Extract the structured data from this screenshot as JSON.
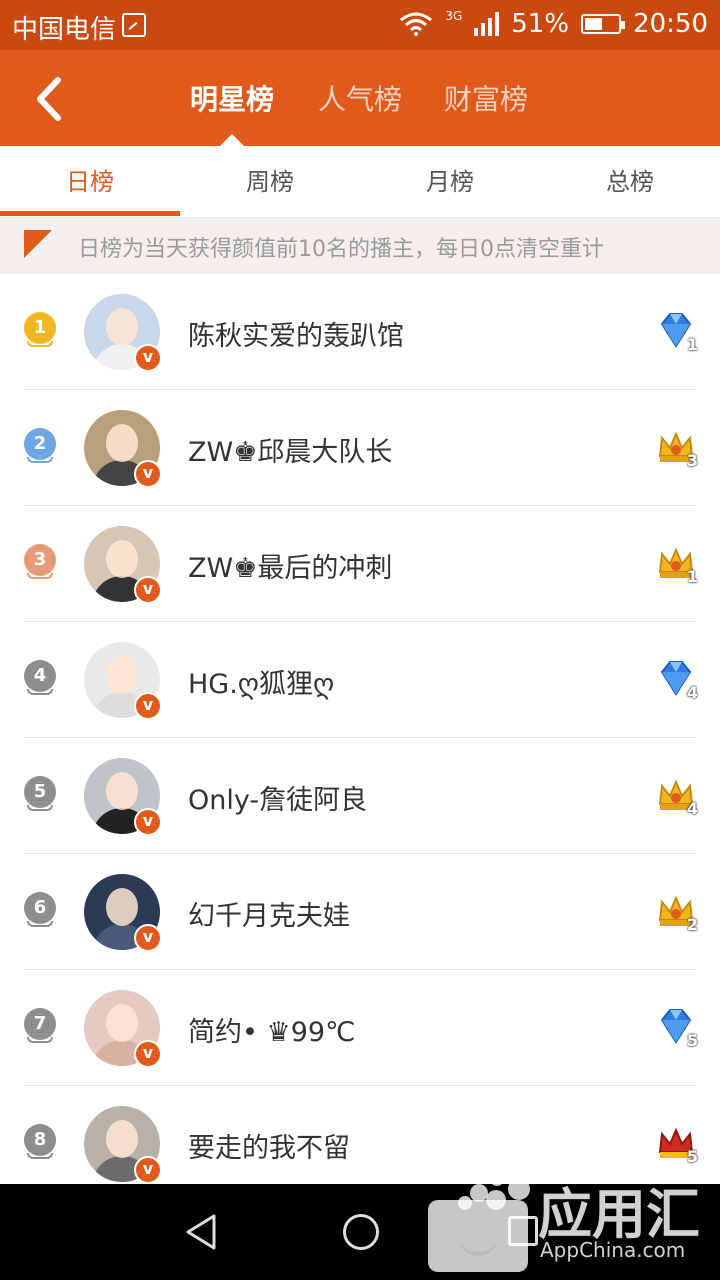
{
  "status_bar": {
    "carrier": "中国电信",
    "network": "3G",
    "battery": "51%",
    "time": "20:50"
  },
  "header": {
    "tabs": [
      {
        "label": "明星榜",
        "active": true
      },
      {
        "label": "人气榜",
        "active": false
      },
      {
        "label": "财富榜",
        "active": false
      }
    ]
  },
  "subtabs": [
    {
      "label": "日榜",
      "active": true
    },
    {
      "label": "周榜",
      "active": false
    },
    {
      "label": "月榜",
      "active": false
    },
    {
      "label": "总榜",
      "active": false
    }
  ],
  "notice": "日榜为当天获得颜值前10名的播主，每日0点清空重计",
  "colors": {
    "accent": "#e05a1c",
    "gold": "#f2b61e",
    "silver": "#6fa6e6",
    "bronze": "#e59b78",
    "gray_rank": "#8e8e8e"
  },
  "list": [
    {
      "rank": "1",
      "name": "陈秋实爱的轰趴馆",
      "badge": {
        "type": "diamond-icon",
        "level": "1"
      }
    },
    {
      "rank": "2",
      "name": "ZW♚邱晨大队长",
      "badge": {
        "type": "crown-icon",
        "level": "3"
      }
    },
    {
      "rank": "3",
      "name": "ZW♚最后的冲刺",
      "badge": {
        "type": "crown-icon",
        "level": "1"
      }
    },
    {
      "rank": "4",
      "name": "HG.ღ狐狸ღ",
      "badge": {
        "type": "diamond-icon",
        "level": "4"
      }
    },
    {
      "rank": "5",
      "name": "Only-詹徒阿良",
      "badge": {
        "type": "crown-icon",
        "level": "4"
      }
    },
    {
      "rank": "6",
      "name": "幻千月克夫娃",
      "badge": {
        "type": "crown-icon",
        "level": "2"
      }
    },
    {
      "rank": "7",
      "name": "简约• ♛99℃",
      "badge": {
        "type": "diamond-icon",
        "level": "5"
      }
    },
    {
      "rank": "8",
      "name": "要走的我不留",
      "badge": {
        "type": "red-crown-icon",
        "level": "5"
      }
    }
  ],
  "verified_badge": "v",
  "watermark": {
    "title": "应用汇",
    "subtitle": "AppChina.com"
  }
}
